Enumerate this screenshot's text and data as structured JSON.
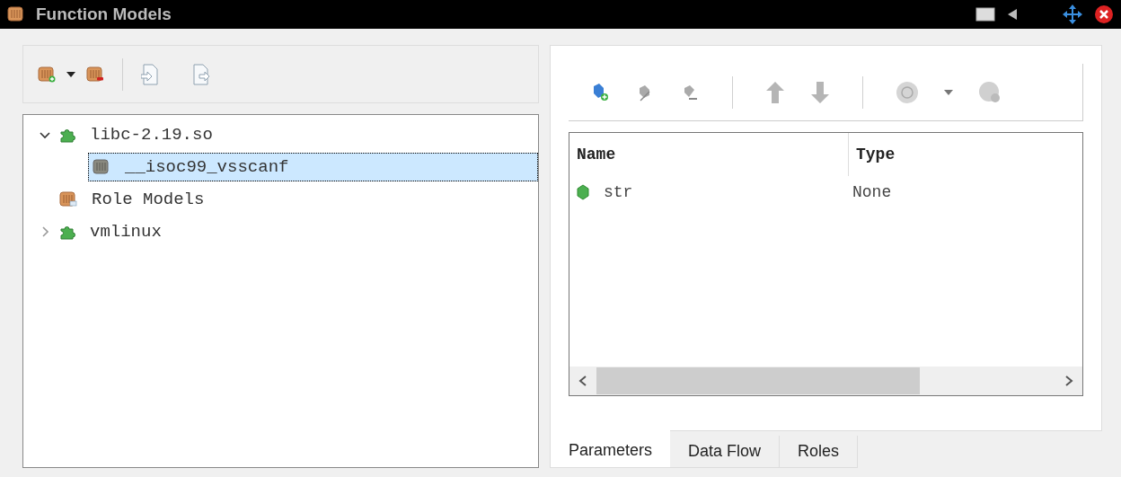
{
  "window": {
    "title": "Function Models"
  },
  "tree": [
    {
      "label": "libc-2.19.so",
      "kind": "library",
      "expanded": true,
      "selected": false,
      "children": [
        {
          "label": "__isoc99_vsscanf",
          "kind": "function",
          "selected": true
        }
      ]
    },
    {
      "label": "Role Models",
      "kind": "roles",
      "selected": false
    },
    {
      "label": "vmlinux",
      "kind": "library",
      "expanded": false,
      "selected": false
    }
  ],
  "table": {
    "columns": [
      "Name",
      "Type"
    ],
    "rows": [
      {
        "name": "str",
        "type": "None"
      }
    ]
  },
  "tabs": [
    {
      "label": "Parameters",
      "selected": true
    },
    {
      "label": "Data Flow",
      "selected": false
    },
    {
      "label": "Roles",
      "selected": false
    }
  ]
}
